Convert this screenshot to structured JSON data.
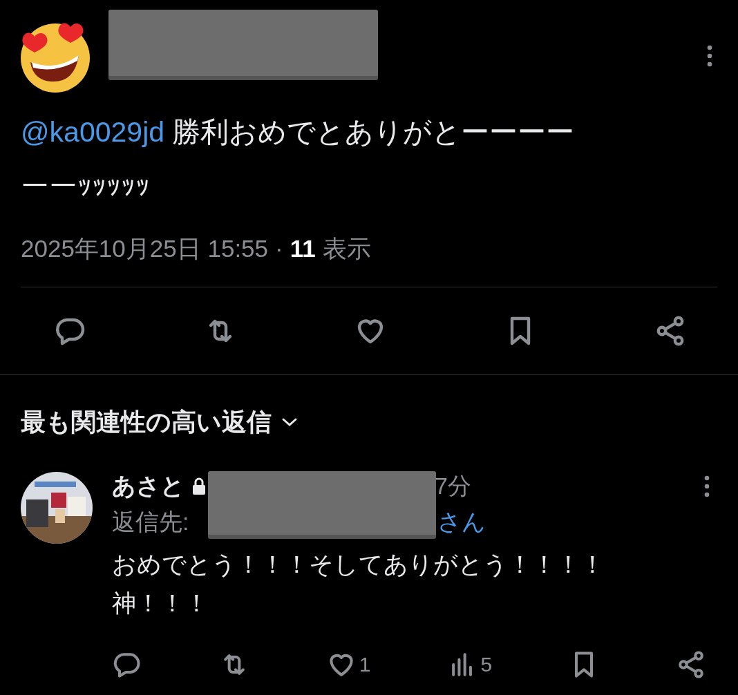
{
  "post": {
    "mention": "@ka0029jd",
    "text_lines": [
      "勝利おめでとありがとーーーー",
      "ーーｯｯｯｯｯ"
    ],
    "timestamp": "2025年10月25日 15:55",
    "separator": "·",
    "views_count": "11",
    "views_label": "表示"
  },
  "post_actions": [
    {
      "kind": "reply"
    },
    {
      "kind": "repost"
    },
    {
      "kind": "like"
    },
    {
      "kind": "bookmark"
    },
    {
      "kind": "share"
    }
  ],
  "replies_heading": "最も関連性の高い返信",
  "reply": {
    "name": "あさと",
    "protected": true,
    "time": "7分",
    "reply_to_label": "返信先:",
    "reply_to_suffix": "さん",
    "text_lines": [
      "おめでとう！！！そしてありがとう！！！！",
      "神！！！"
    ],
    "actions": [
      {
        "kind": "reply"
      },
      {
        "kind": "repost"
      },
      {
        "kind": "like",
        "count": "1"
      },
      {
        "kind": "views",
        "count": "5"
      },
      {
        "kind": "bookmark"
      },
      {
        "kind": "share"
      }
    ]
  }
}
